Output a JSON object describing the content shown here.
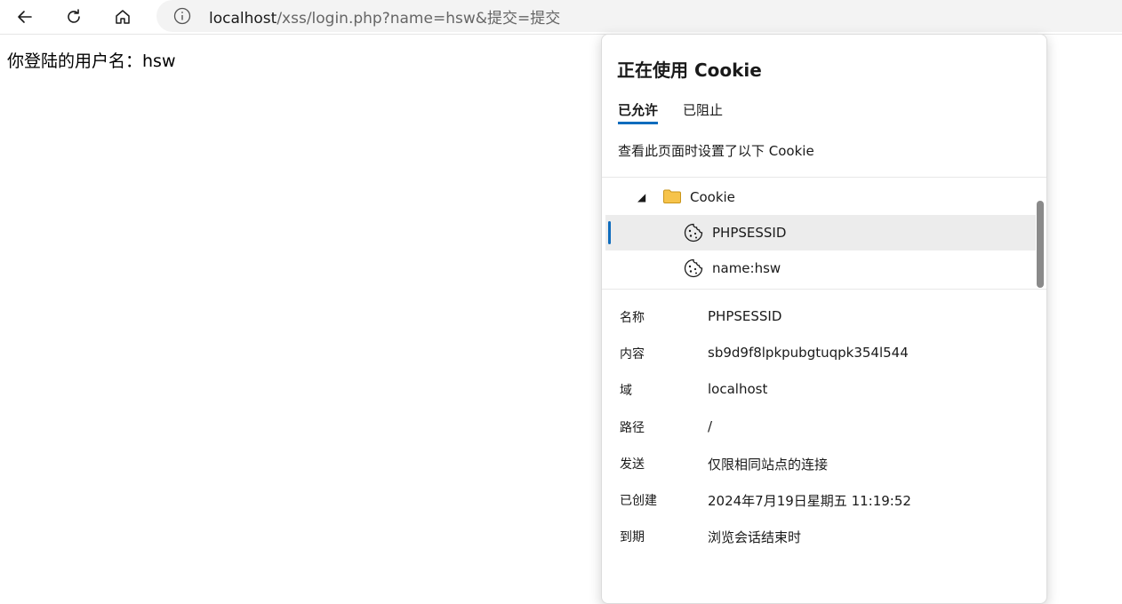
{
  "browser": {
    "url_host": "localhost",
    "url_rest": "/xss/login.php?name=hsw&提交=提交"
  },
  "page": {
    "text": "你登陆的用户名：hsw"
  },
  "cookie_popup": {
    "title": "正在使用 Cookie",
    "tabs": [
      {
        "label": "已允许",
        "active": true
      },
      {
        "label": "已阻止",
        "active": false
      }
    ],
    "description": "查看此页面时设置了以下 Cookie",
    "tree": {
      "folder_label": "Cookie",
      "items": [
        {
          "label": "PHPSESSID",
          "selected": true
        },
        {
          "label": "name:hsw",
          "selected": false
        }
      ]
    },
    "details": [
      {
        "key": "名称",
        "value": "PHPSESSID"
      },
      {
        "key": "内容",
        "value": "sb9d9f8lpkpubgtuqpk354l544"
      },
      {
        "key": "域",
        "value": "localhost"
      },
      {
        "key": "路径",
        "value": "/"
      },
      {
        "key": "发送",
        "value": "仅限相同站点的连接"
      },
      {
        "key": "已创建",
        "value": "2024年7月19日星期五 11:19:52"
      },
      {
        "key": "到期",
        "value": "浏览会话结束时"
      }
    ]
  },
  "colors": {
    "accent": "#0f6cbd",
    "folder": "#f6c34a"
  }
}
